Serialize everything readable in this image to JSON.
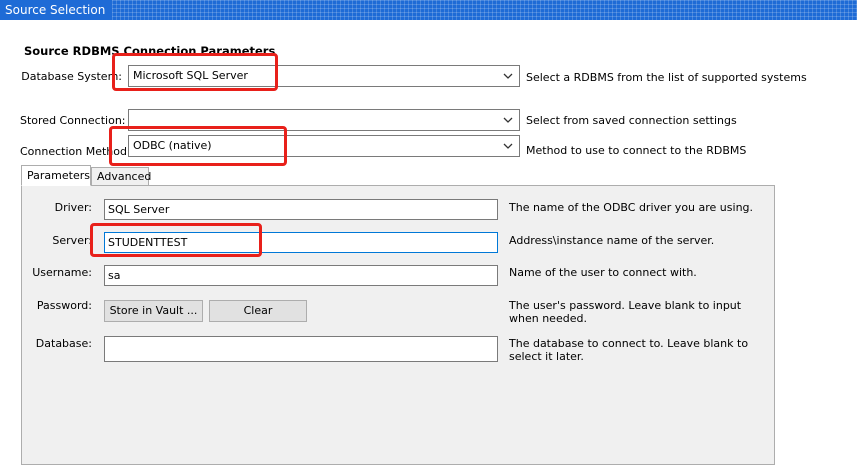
{
  "window": {
    "title": "Source Selection"
  },
  "section": {
    "title": "Source RDBMS Connection Parameters"
  },
  "database_system": {
    "label": "Database System:",
    "value": "Microsoft SQL Server",
    "hint": "Select a RDBMS from the list of supported systems",
    "icon": "chevron-down-icon"
  },
  "stored_connection": {
    "label": "Stored Connection:",
    "value": "",
    "hint": "Select from saved connection settings"
  },
  "connection_method": {
    "label": "Connection Method:",
    "value": "ODBC (native)",
    "hint": "Method to use to connect to the RDBMS"
  },
  "tabs": [
    {
      "label": "Parameters",
      "active": true
    },
    {
      "label": "Advanced",
      "active": false
    }
  ],
  "params": {
    "driver": {
      "label": "Driver:",
      "value": "SQL Server",
      "hint": "The name of the ODBC driver you are using."
    },
    "server": {
      "label": "Server:",
      "value": "STUDENTTEST",
      "hint": "Address\\instance name of the server."
    },
    "username": {
      "label": "Username:",
      "value": "sa",
      "hint": "Name of the user to connect with."
    },
    "password": {
      "label": "Password:",
      "store_button": "Store in Vault ...",
      "clear_button": "Clear",
      "hint": "The user's password. Leave blank to input when needed."
    },
    "database": {
      "label": "Database:",
      "value": "",
      "hint": "The database to connect to. Leave blank to select it later."
    }
  },
  "colors": {
    "titlebar": "#1e6bd6",
    "annotation": "#e8201a",
    "panel": "#f0f0f0"
  }
}
